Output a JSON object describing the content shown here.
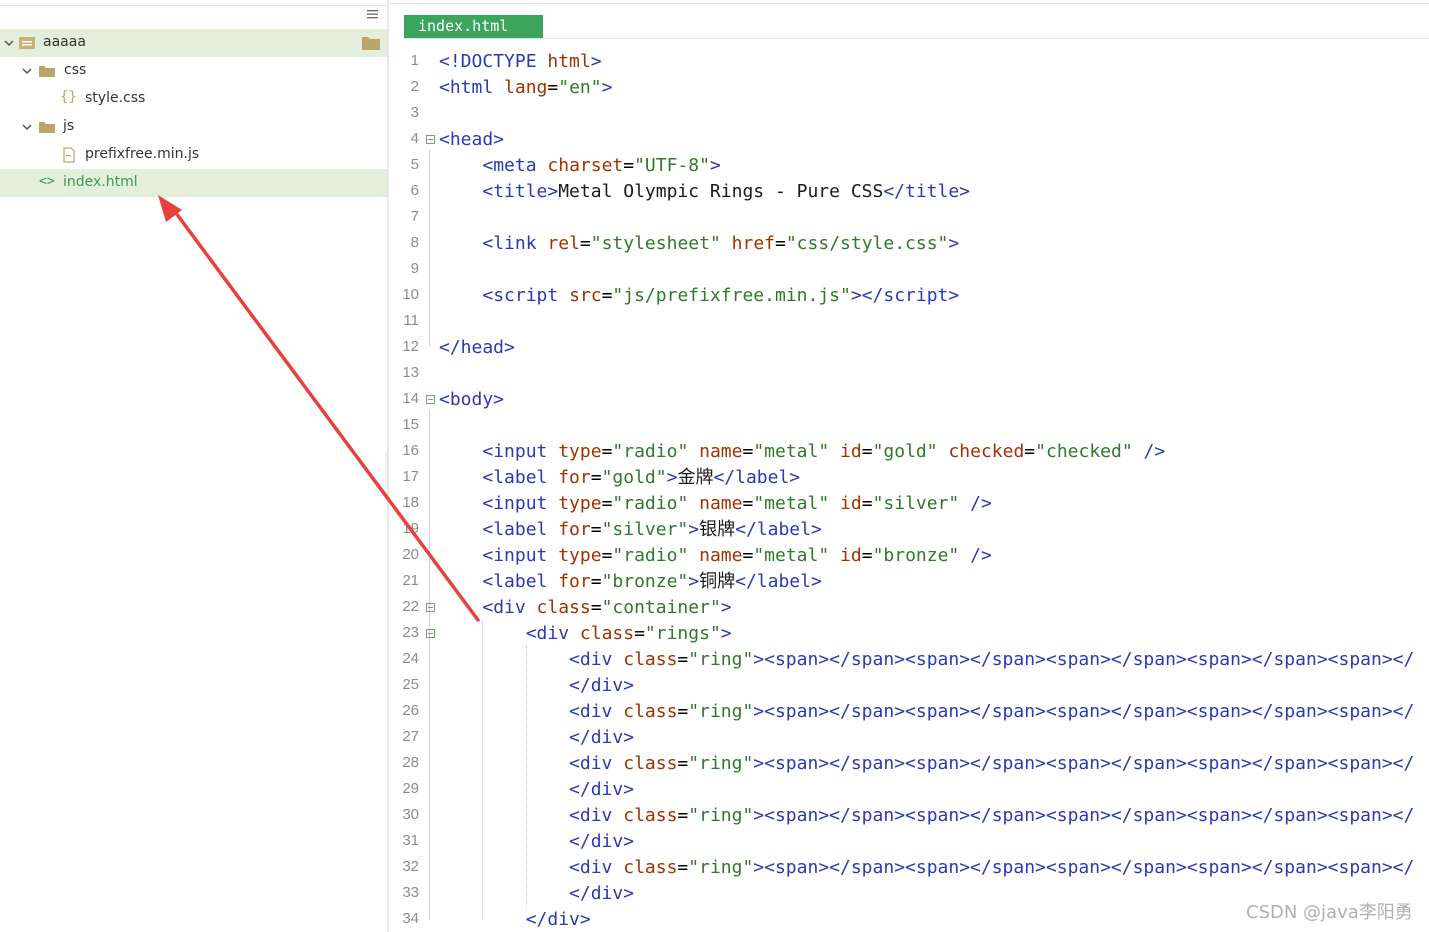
{
  "sidebar": {
    "items": [
      {
        "label": "aaaaa",
        "type": "folder",
        "expanded": true
      },
      {
        "label": "css",
        "type": "folder",
        "expanded": true
      },
      {
        "label": "style.css",
        "type": "css-file"
      },
      {
        "label": "js",
        "type": "folder",
        "expanded": true
      },
      {
        "label": "prefixfree.min.js",
        "type": "js-file"
      },
      {
        "label": "index.html",
        "type": "html-file"
      }
    ]
  },
  "editor": {
    "tab_label": "index.html",
    "line_numbers": [
      "1",
      "2",
      "3",
      "4",
      "5",
      "6",
      "7",
      "8",
      "9",
      "10",
      "11",
      "12",
      "13",
      "14",
      "15",
      "16",
      "17",
      "18",
      "19",
      "20",
      "21",
      "22",
      "23",
      "24",
      "25",
      "26",
      "27",
      "28",
      "29",
      "30",
      "31",
      "32",
      "33",
      "34"
    ]
  },
  "colors": {
    "tab_active": "#3ca55c",
    "selection": "#e3eedb",
    "tag": "#2a3ab4",
    "attribute": "#a23100",
    "value": "#2f7a2a",
    "arrow": "#e8403a"
  },
  "watermark": "CSDN @java李阳勇"
}
